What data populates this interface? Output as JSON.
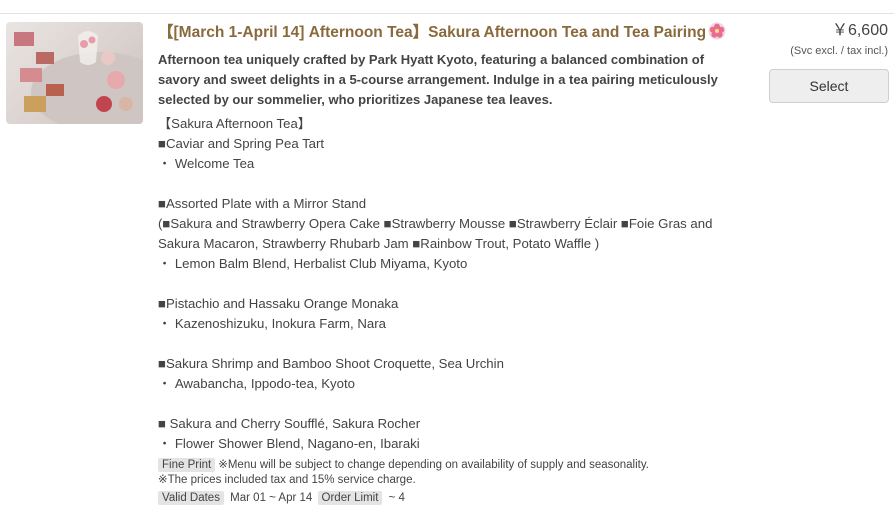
{
  "plan": {
    "title": "【[March 1-April 14] Afternoon Tea】Sakura Afternoon Tea and Tea Pairing",
    "description": "Afternoon tea uniquely crafted by Park Hyatt Kyoto, featuring a balanced combination of savory and sweet delights in a 5-course arrangement. Indulge in a tea pairing meticulously selected by our sommelier, who prioritizes Japanese tea leaves.",
    "menu_lines": [
      "【Sakura Afternoon Tea】",
      "■Caviar and Spring Pea Tart",
      "・ Welcome Tea",
      "",
      "■Assorted Plate with a Mirror Stand",
      "(■Sakura and Strawberry Opera Cake ■Strawberry Mousse ■Strawberry Éclair ■Foie Gras and",
      "Sakura Macaron, Strawberry Rhubarb Jam ■Rainbow Trout, Potato Waffle )",
      "・ Lemon Balm Blend, Herbalist Club Miyama, Kyoto",
      "",
      "■Pistachio and Hassaku Orange Monaka",
      "・ Kazenoshizuku, Inokura Farm, Nara",
      "",
      "■Sakura Shrimp and Bamboo Shoot Croquette, Sea Urchin",
      "・ Awabancha, Ippodo-tea, Kyoto",
      "",
      "■ Sakura and Cherry Soufflé, Sakura Rocher",
      "・ Flower Shower Blend, Nagano-en, Ibaraki"
    ]
  },
  "price": {
    "amount": "￥6,600",
    "tax_note": "(Svc excl. / tax incl.)"
  },
  "select_button": {
    "label": "Select"
  },
  "fine_print": {
    "tag": "Fine Print",
    "line1": "※Menu will be subject to change depending on availability of supply and seasonality.",
    "line2": "※The prices included tax and 15% service charge."
  },
  "valid_dates": {
    "tag": "Valid Dates",
    "value": "Mar 01 ~ Apr 14"
  },
  "order_limit": {
    "tag": "Order Limit",
    "value": "~ 4"
  },
  "colors": {
    "title": "#8a6a3d",
    "button_bg": "#eeeeee"
  },
  "icons": {
    "title_flower": "cherry-blossom-icon"
  }
}
